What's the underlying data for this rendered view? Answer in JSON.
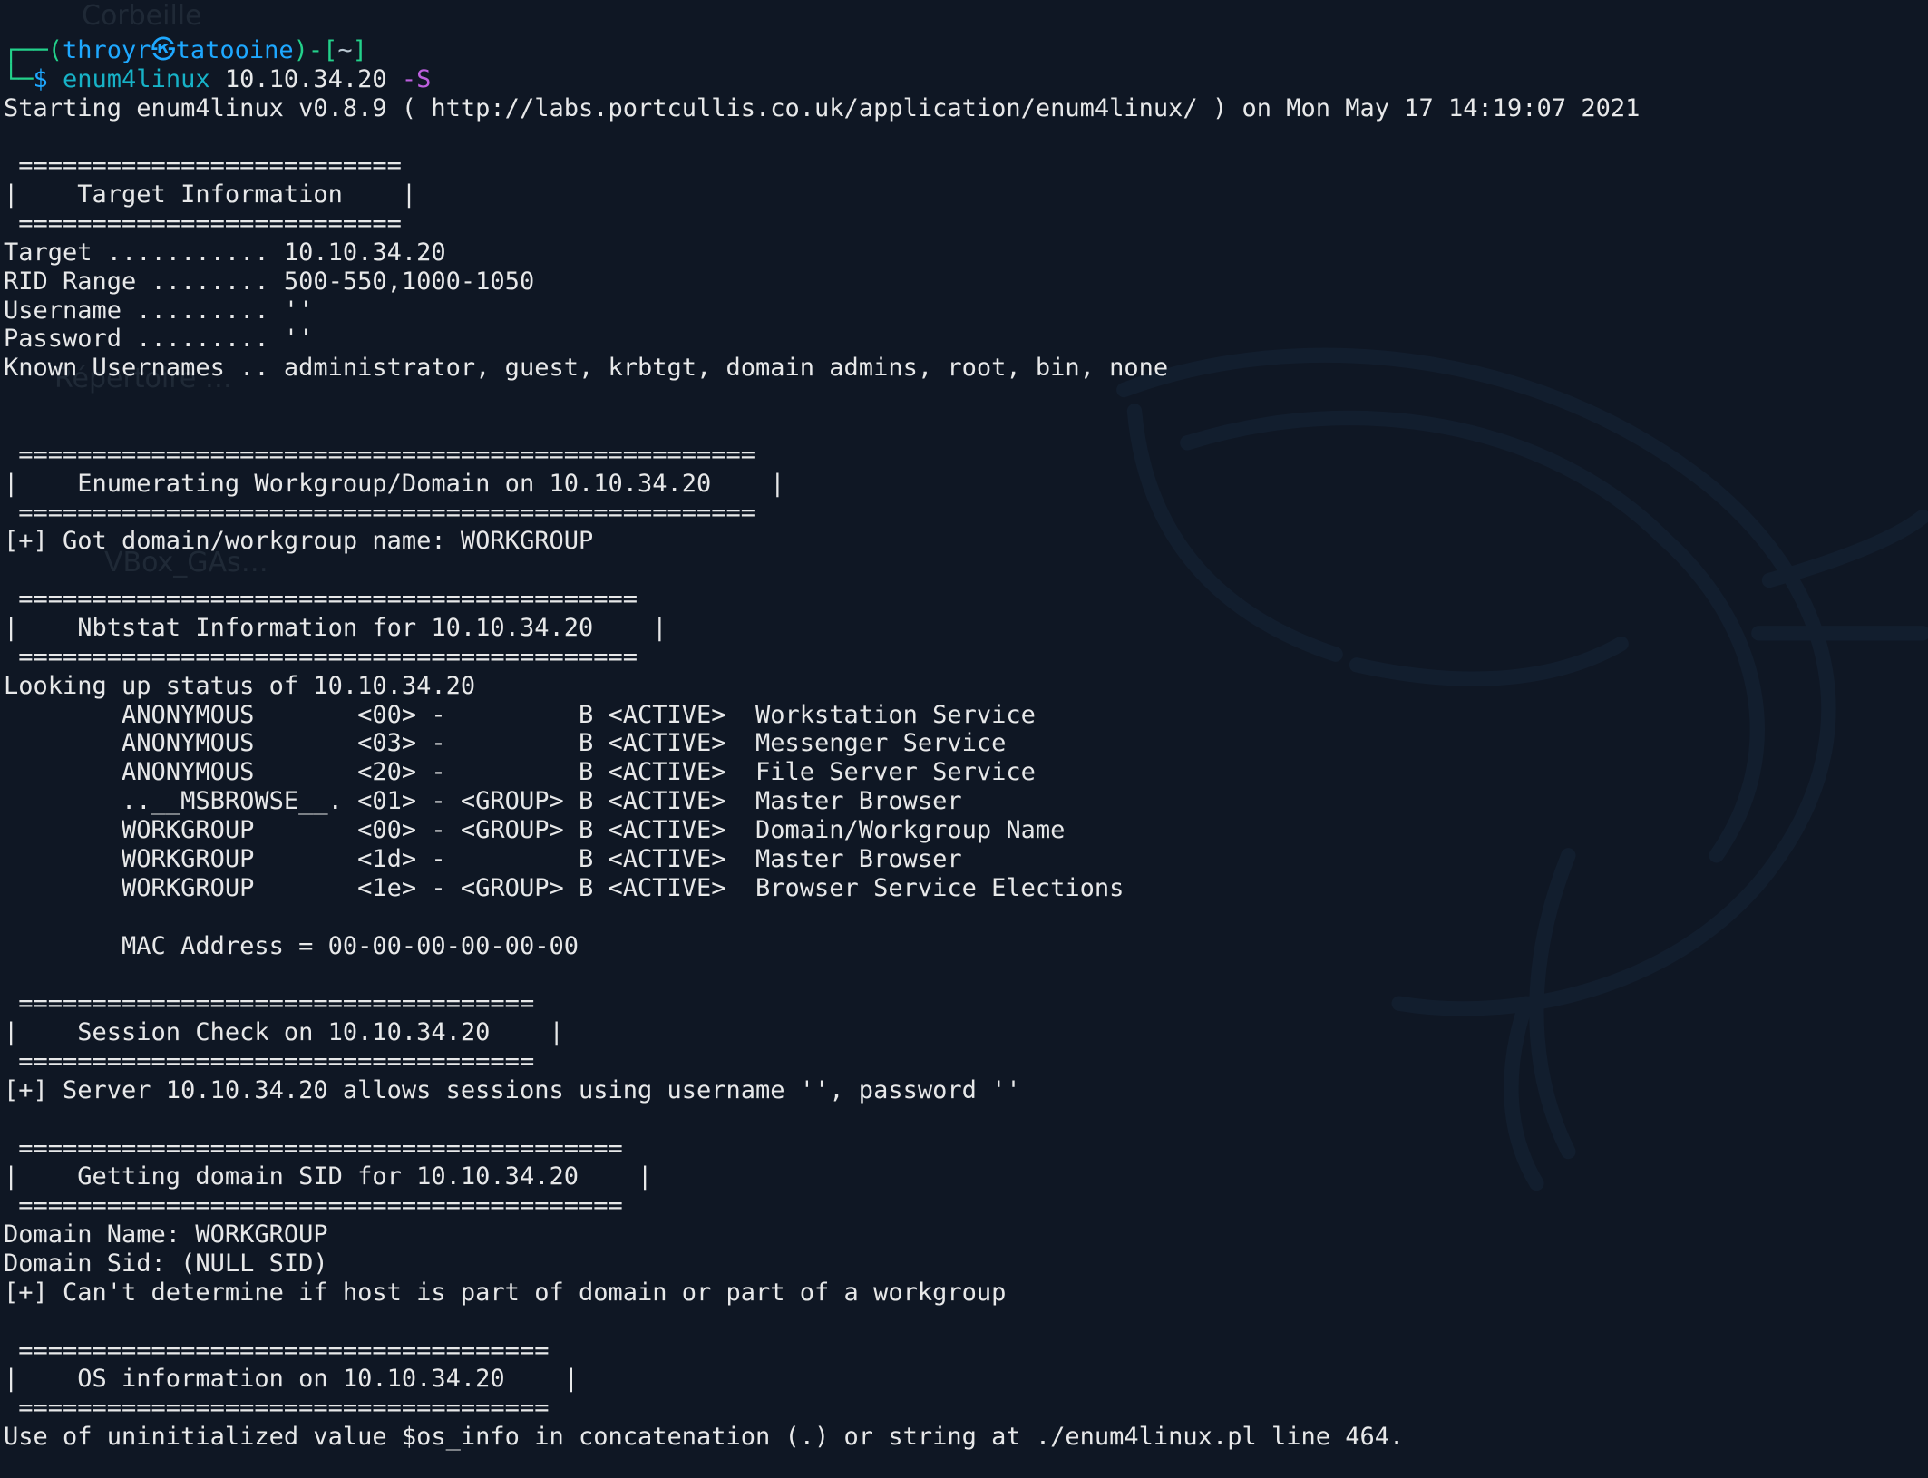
{
  "desktop_ghosts": {
    "corbeille": "Corbeille",
    "repertoire": "Répertoire …",
    "vbox": "VBox_GAs…"
  },
  "prompt": {
    "l_paren": "┌──(",
    "user": "throyr",
    "emoji": "㉿",
    "host": "tatooine",
    "r_paren": ")-[",
    "cwd": "~",
    "close": "]",
    "line2_prefix": "└─",
    "dollar": "$ ",
    "cmd": "enum4linux",
    "arg_ip": " 10.10.34.20 ",
    "arg_flag": "-S"
  },
  "output": "Starting enum4linux v0.8.9 ( http://labs.portcullis.co.uk/application/enum4linux/ ) on Mon May 17 14:19:07 2021\n\n ========================== \n|    Target Information    |\n ========================== \nTarget ........... 10.10.34.20\nRID Range ........ 500-550,1000-1050\nUsername ......... ''\nPassword ......... ''\nKnown Usernames .. administrator, guest, krbtgt, domain admins, root, bin, none\n\n\n ================================================== \n|    Enumerating Workgroup/Domain on 10.10.34.20    |\n ================================================== \n[+] Got domain/workgroup name: WORKGROUP\n\n ========================================== \n|    Nbtstat Information for 10.10.34.20    |\n ========================================== \nLooking up status of 10.10.34.20\n        ANONYMOUS       <00> -         B <ACTIVE>  Workstation Service\n        ANONYMOUS       <03> -         B <ACTIVE>  Messenger Service\n        ANONYMOUS       <20> -         B <ACTIVE>  File Server Service\n        ..__MSBROWSE__. <01> - <GROUP> B <ACTIVE>  Master Browser\n        WORKGROUP       <00> - <GROUP> B <ACTIVE>  Domain/Workgroup Name\n        WORKGROUP       <1d> -         B <ACTIVE>  Master Browser\n        WORKGROUP       <1e> - <GROUP> B <ACTIVE>  Browser Service Elections\n\n        MAC Address = 00-00-00-00-00-00\n\n =================================== \n|    Session Check on 10.10.34.20    |\n =================================== \n[+] Server 10.10.34.20 allows sessions using username '', password ''\n\n ========================================= \n|    Getting domain SID for 10.10.34.20    |\n ========================================= \nDomain Name: WORKGROUP\nDomain Sid: (NULL SID)\n[+] Can't determine if host is part of domain or part of a workgroup\n\n ==================================== \n|    OS information on 10.10.34.20    |\n ==================================== \nUse of uninitialized value $os_info in concatenation (.) or string at ./enum4linux.pl line 464."
}
